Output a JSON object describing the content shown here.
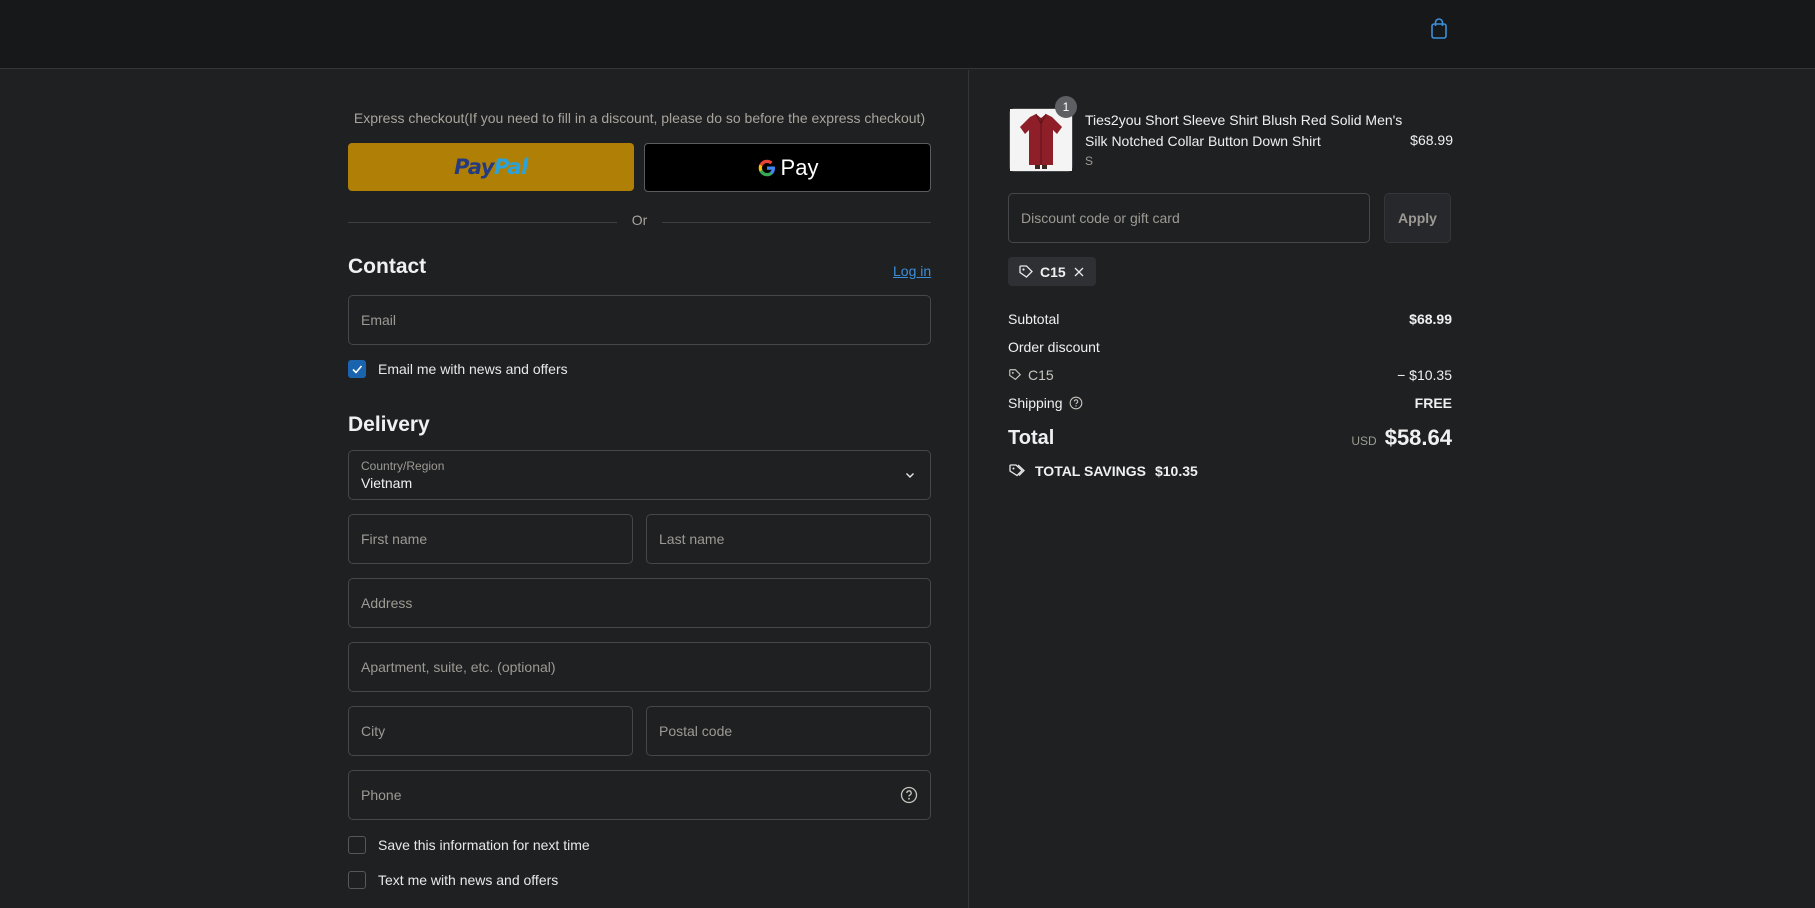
{
  "header": {
    "cart_icon": "shopping-bag-icon"
  },
  "express": {
    "title": "Express checkout(If you need to fill in a discount, please do so before the express checkout)",
    "paypal_part1": "Pay",
    "paypal_part2": "Pal",
    "gpay_label": "Pay",
    "divider_text": "Or"
  },
  "contact": {
    "title": "Contact",
    "login_link": "Log in",
    "email_placeholder": "Email",
    "news_checkbox_label": "Email me with news and offers",
    "news_checked": true
  },
  "delivery": {
    "title": "Delivery",
    "country_label": "Country/Region",
    "country_value": "Vietnam",
    "first_name_placeholder": "First name",
    "last_name_placeholder": "Last name",
    "address_placeholder": "Address",
    "apartment_placeholder": "Apartment, suite, etc. (optional)",
    "city_placeholder": "City",
    "postal_placeholder": "Postal code",
    "phone_placeholder": "Phone",
    "save_info_label": "Save this information for next time",
    "text_me_label": "Text me with news and offers"
  },
  "summary": {
    "product": {
      "name": "Ties2you Short Sleeve Shirt Blush Red Solid Men's Silk Notched Collar Button Down Shirt",
      "variant": "S",
      "price": "$68.99",
      "quantity": "1"
    },
    "discount_placeholder": "Discount code or gift card",
    "apply_label": "Apply",
    "applied_code": "C15",
    "subtotal_label": "Subtotal",
    "subtotal_value": "$68.99",
    "order_discount_label": "Order discount",
    "discount_code": "C15",
    "discount_value": "− $10.35",
    "shipping_label": "Shipping",
    "shipping_value": "FREE",
    "total_label": "Total",
    "total_currency": "USD",
    "total_value": "$58.64",
    "savings_label": "TOTAL SAVINGS",
    "savings_value": "$10.35"
  },
  "colors": {
    "background": "#1f2022",
    "header": "#17181a",
    "paypal_button": "#b07f06",
    "accent_link": "#3b8fd9",
    "checkbox_checked": "#1a63ae"
  }
}
